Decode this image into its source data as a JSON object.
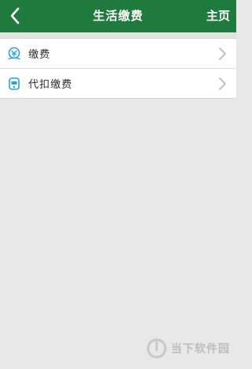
{
  "header": {
    "title": "生活缴费",
    "home_label": "主页"
  },
  "colors": {
    "header_bg": "#1f7a3e",
    "page_bg": "#e8e8e8",
    "icon_blue": "#2aa0dc"
  },
  "list": {
    "items": [
      {
        "label": "缴费",
        "icon": "payment-icon"
      },
      {
        "label": "代扣缴费",
        "icon": "auto-debit-icon"
      }
    ]
  },
  "watermark": {
    "text": "当下软件园"
  }
}
